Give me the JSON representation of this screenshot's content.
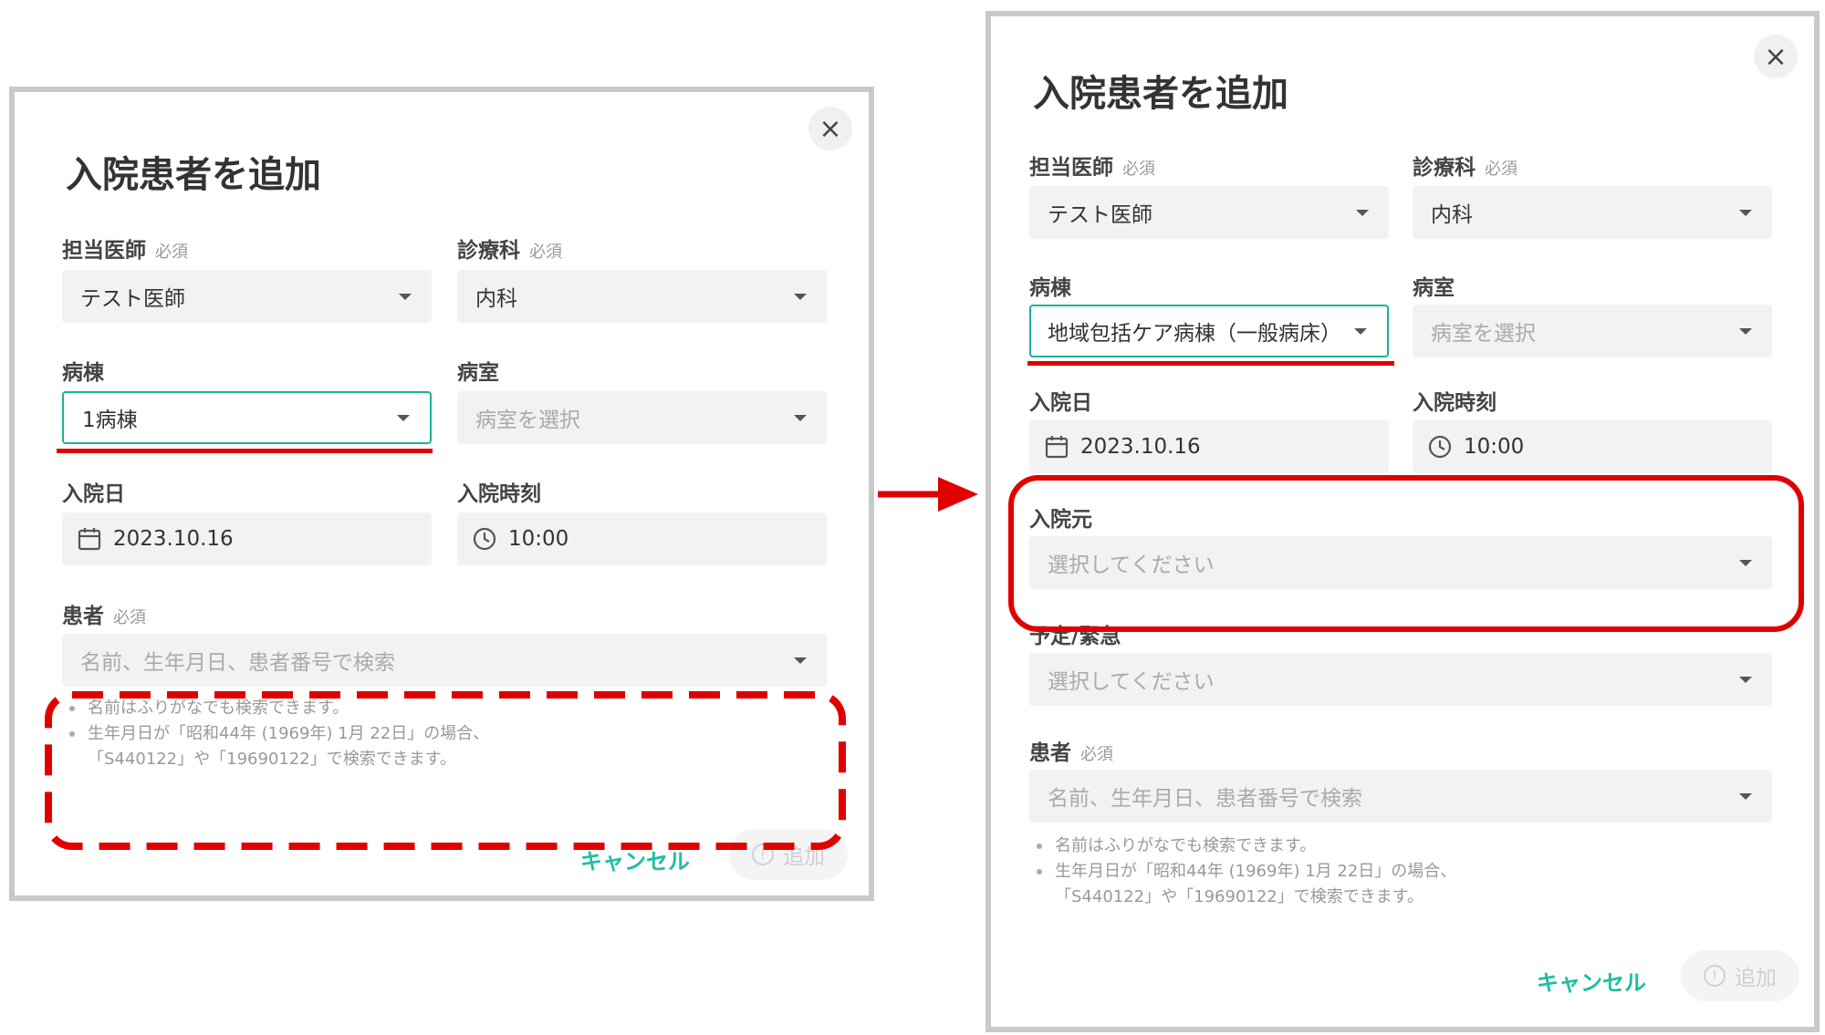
{
  "dialog": {
    "title": "入院患者を追加",
    "close_icon": "×",
    "required_tag": "必須",
    "doctor": {
      "label": "担当医師",
      "value": "テスト医師"
    },
    "department": {
      "label": "診療科",
      "value": "内科"
    },
    "ward": {
      "label": "病棟"
    },
    "room": {
      "label": "病室",
      "placeholder": "病室を選択"
    },
    "admission_date": {
      "label": "入院日",
      "value": "2023.10.16"
    },
    "admission_time": {
      "label": "入院時刻",
      "value": "10:00"
    },
    "patient": {
      "label": "患者",
      "placeholder": "名前、生年月日、患者番号で検索"
    },
    "hints": [
      "名前はふりがなでも検索できます。",
      "生年月日が「昭和44年 (1969年) 1月 22日」の場合、",
      "「S440122」や「19690122」で検索できます。"
    ],
    "cancel_label": "キャンセル",
    "add_label": "追加",
    "add_icon": "!"
  },
  "before": {
    "ward_value": "1病棟"
  },
  "after": {
    "ward_value": "地域包括ケア病棟（一般病床）",
    "source": {
      "label": "入院元",
      "placeholder": "選択してください"
    },
    "planned": {
      "label": "予定/緊急",
      "placeholder": "選択してください"
    }
  },
  "colors": {
    "accent": "#19b39a",
    "highlight": "#e00000",
    "border": "#c9c9c9"
  },
  "icons": {
    "date": "calendar-icon",
    "time": "clock-icon",
    "dropdown": "chevron-down-icon",
    "close": "close-icon"
  }
}
